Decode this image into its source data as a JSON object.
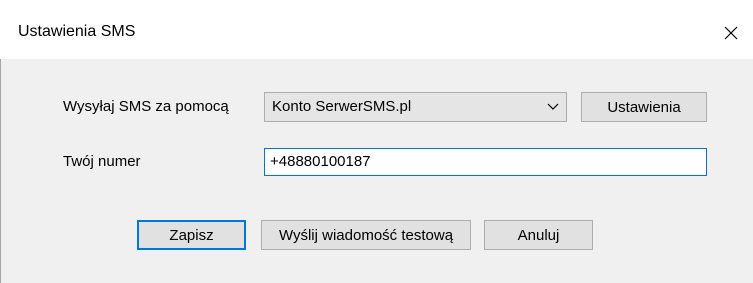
{
  "window": {
    "title": "Ustawienia SMS",
    "close_icon": "close-icon"
  },
  "form": {
    "send_via_label": "Wysyłaj SMS za pomocą",
    "send_via_value": "Konto SerwerSMS.pl",
    "settings_button": "Ustawienia",
    "number_label": "Twój numer",
    "number_value": "+48880100187"
  },
  "buttons": {
    "save": "Zapisz",
    "send_test": "Wyślij wiadomość testową",
    "cancel": "Anuluj"
  },
  "colors": {
    "accent": "#0078d7",
    "dialog_bg": "#f0f0f0",
    "button_bg": "#e1e1e1"
  }
}
